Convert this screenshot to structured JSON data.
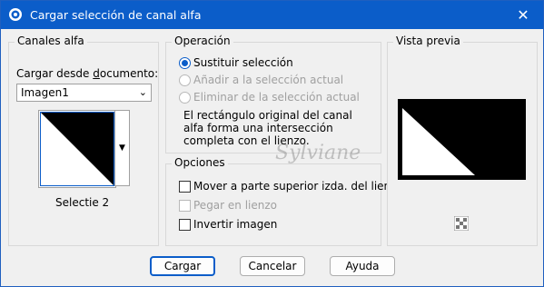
{
  "window": {
    "title": "Cargar selección de canal alfa",
    "title_icon": "psp-channel-icon",
    "close_label": "✕"
  },
  "alpha": {
    "group_title": "Canales alfa",
    "load_label": "Cargar desde documento:",
    "document": "Imagen1",
    "channel_name": "Selectie 2"
  },
  "operation": {
    "group_title": "Operación",
    "options": [
      {
        "label": "Sustituir selección",
        "selected": true,
        "enabled": true
      },
      {
        "label": "Añadir a la selección actual",
        "selected": false,
        "enabled": false
      },
      {
        "label": "Eliminar de la selección actual",
        "selected": false,
        "enabled": false
      }
    ],
    "description": "El rectángulo original del canal alfa forma una intersección completa con el lienzo."
  },
  "options": {
    "group_title": "Opciones",
    "items": [
      {
        "label": "Mover a parte superior izda. del lienzo",
        "checked": false,
        "enabled": true
      },
      {
        "label": "Pegar en lienzo",
        "checked": false,
        "enabled": false
      },
      {
        "label": "Invertir imagen",
        "checked": false,
        "enabled": true
      }
    ]
  },
  "preview": {
    "group_title": "Vista previa",
    "zoom_icon": "checker-icon"
  },
  "watermark": "Sylviane",
  "buttons": {
    "ok": "Cargar",
    "cancel": "Cancelar",
    "help": "Ayuda"
  },
  "colors": {
    "titlebar": "#0b5dc9",
    "accent": "#0b5dc9"
  }
}
